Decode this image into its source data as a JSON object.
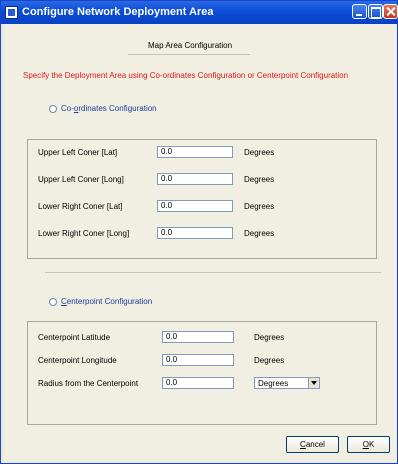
{
  "window": {
    "title": "Configure Network Deployment Area",
    "icon": "app-network-icon"
  },
  "heading": "Map Area Configuration",
  "instruction": "Specify the Deployment Area using Co-ordinates Configuration or Centerpoint Configuration",
  "coords": {
    "radio_label_pre": "Co-",
    "radio_label_ul": "o",
    "radio_label_post": "rdinates Configuration",
    "fields": [
      {
        "label": "Upper Left Coner [Lat]",
        "value": "0.0",
        "unit": "Degrees"
      },
      {
        "label": "Upper Left Coner [Long]",
        "value": "0.0",
        "unit": "Degrees"
      },
      {
        "label": "Lower Right Coner [Lat]",
        "value": "0.0",
        "unit": "Degrees"
      },
      {
        "label": "Lower Right Coner [Long]",
        "value": "0.0",
        "unit": "Degrees"
      }
    ]
  },
  "centerpoint": {
    "radio_label_ul": "C",
    "radio_label_post": "enterpoint Configuration",
    "fields": [
      {
        "label": "Centerpoint Latitude",
        "value": "0.0",
        "unit": "Degrees"
      },
      {
        "label": "Centerpoint Longitude",
        "value": "0.0",
        "unit": "Degrees"
      },
      {
        "label": "Radius from the Centerpoint",
        "value": "0.0",
        "unit": "Degrees"
      }
    ],
    "radius_unit_selected": "Degrees"
  },
  "buttons": {
    "cancel_ul": "C",
    "cancel_rest": "ancel",
    "ok_ul": "O",
    "ok_rest": "K"
  },
  "colors": {
    "instruction": "#e01818",
    "radio_label": "#1e3d9b",
    "titlebar": "#0a4cd6"
  }
}
